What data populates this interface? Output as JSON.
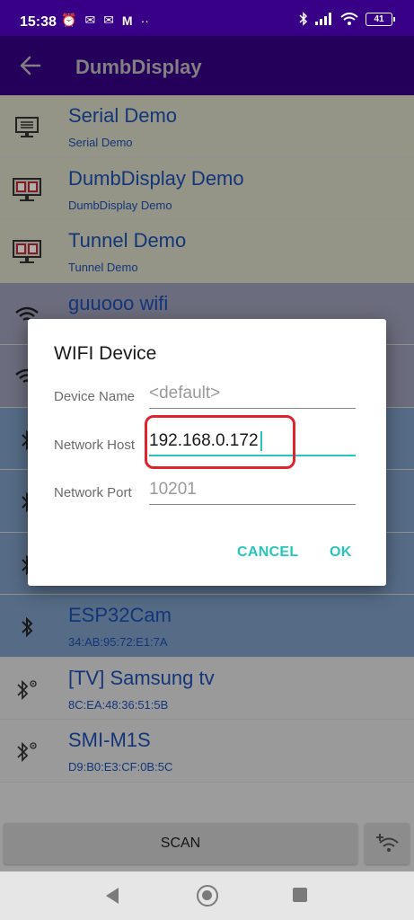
{
  "status_bar": {
    "time": "15:38",
    "left_icons": [
      "alarm-icon",
      "notification-icon",
      "notification-icon",
      "gmail-icon",
      "more-dots-icon"
    ],
    "right_icons": [
      "bluetooth-icon",
      "signal-icon",
      "wifi-icon"
    ],
    "battery": "41"
  },
  "toolbar": {
    "title": "DumbDisplay"
  },
  "devices": [
    {
      "name": "Serial Demo",
      "sub": "Serial Demo",
      "icon": "monitor-icon",
      "bg": "yellow"
    },
    {
      "name": "DumbDisplay Demo",
      "sub": "DumbDisplay Demo",
      "icon": "dumbdisplay-icon",
      "bg": "yellow"
    },
    {
      "name": "Tunnel Demo",
      "sub": "Tunnel Demo",
      "icon": "dumbdisplay-icon",
      "bg": "yellow"
    },
    {
      "name": "guuooo wifi",
      "sub": "",
      "icon": "wifi-icon",
      "bg": "grey"
    },
    {
      "name": "",
      "sub": "",
      "icon": "wifi-icon",
      "bg": "grey"
    },
    {
      "name": "",
      "sub": "",
      "icon": "bluetooth-icon",
      "bg": "blue"
    },
    {
      "name": "",
      "sub": "",
      "icon": "bluetooth-icon",
      "bg": "blue"
    },
    {
      "name": "",
      "sub": "",
      "icon": "bluetooth-icon",
      "bg": "blue"
    },
    {
      "name": "ESP32Cam",
      "sub": "34:AB:95:72:E1:7A",
      "icon": "bluetooth-icon",
      "bg": "blue"
    },
    {
      "name": "[TV] Samsung tv",
      "sub": "8C:EA:48:36:51:5B",
      "icon": "bluetooth-paired-icon",
      "bg": "white"
    },
    {
      "name": "SMI-M1S",
      "sub": "D9:B0:E3:CF:0B:5C",
      "icon": "bluetooth-paired-icon",
      "bg": "white"
    }
  ],
  "scan_button": "SCAN",
  "dialog": {
    "title": "WIFI Device",
    "device_name_label": "Device Name",
    "device_name_placeholder": "<default>",
    "network_host_label": "Network Host",
    "network_host_value": "192.168.0.172",
    "network_port_label": "Network Port",
    "network_port_placeholder": "10201",
    "cancel": "CANCEL",
    "ok": "OK"
  },
  "colors": {
    "primary": "#370087",
    "accent": "#26c6bf",
    "highlight": "#e0242e",
    "device_name": "#1d4fb3"
  }
}
